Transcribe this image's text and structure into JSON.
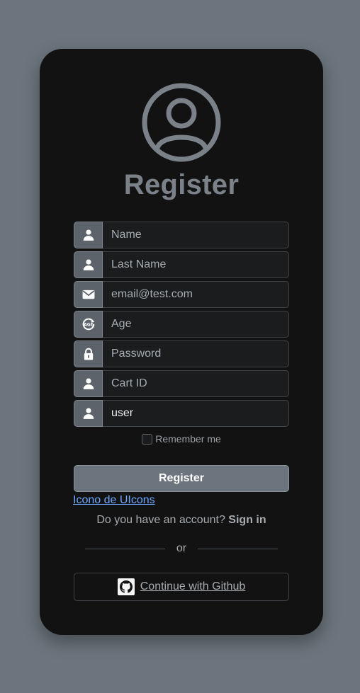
{
  "header": {
    "title": "Register",
    "avatar_icon": "user-circle-icon"
  },
  "fields": [
    {
      "icon": "user-icon",
      "placeholder": "Name",
      "value": ""
    },
    {
      "icon": "user-icon",
      "placeholder": "Last Name",
      "value": ""
    },
    {
      "icon": "envelope-icon",
      "placeholder": "email@test.com",
      "value": ""
    },
    {
      "icon": "age-icon",
      "placeholder": "Age",
      "value": ""
    },
    {
      "icon": "lock-icon",
      "placeholder": "Password",
      "value": ""
    },
    {
      "icon": "user-icon",
      "placeholder": "Cart ID",
      "value": ""
    },
    {
      "icon": "user-icon",
      "placeholder": "",
      "value": "user"
    }
  ],
  "remember": {
    "label": "Remember me",
    "checked": false
  },
  "register_button": {
    "label": "Register"
  },
  "credit_link": {
    "label": "Icono de UIcons"
  },
  "signin": {
    "prompt": "Do you have an account?",
    "link": "Sign in"
  },
  "divider": {
    "label": "or"
  },
  "github_button": {
    "label": "Continue with Github",
    "icon": "github-icon"
  },
  "colors": {
    "background": "#6c757d",
    "card": "#121212",
    "addon": "#5c636a",
    "link": "#6ea8fe"
  }
}
